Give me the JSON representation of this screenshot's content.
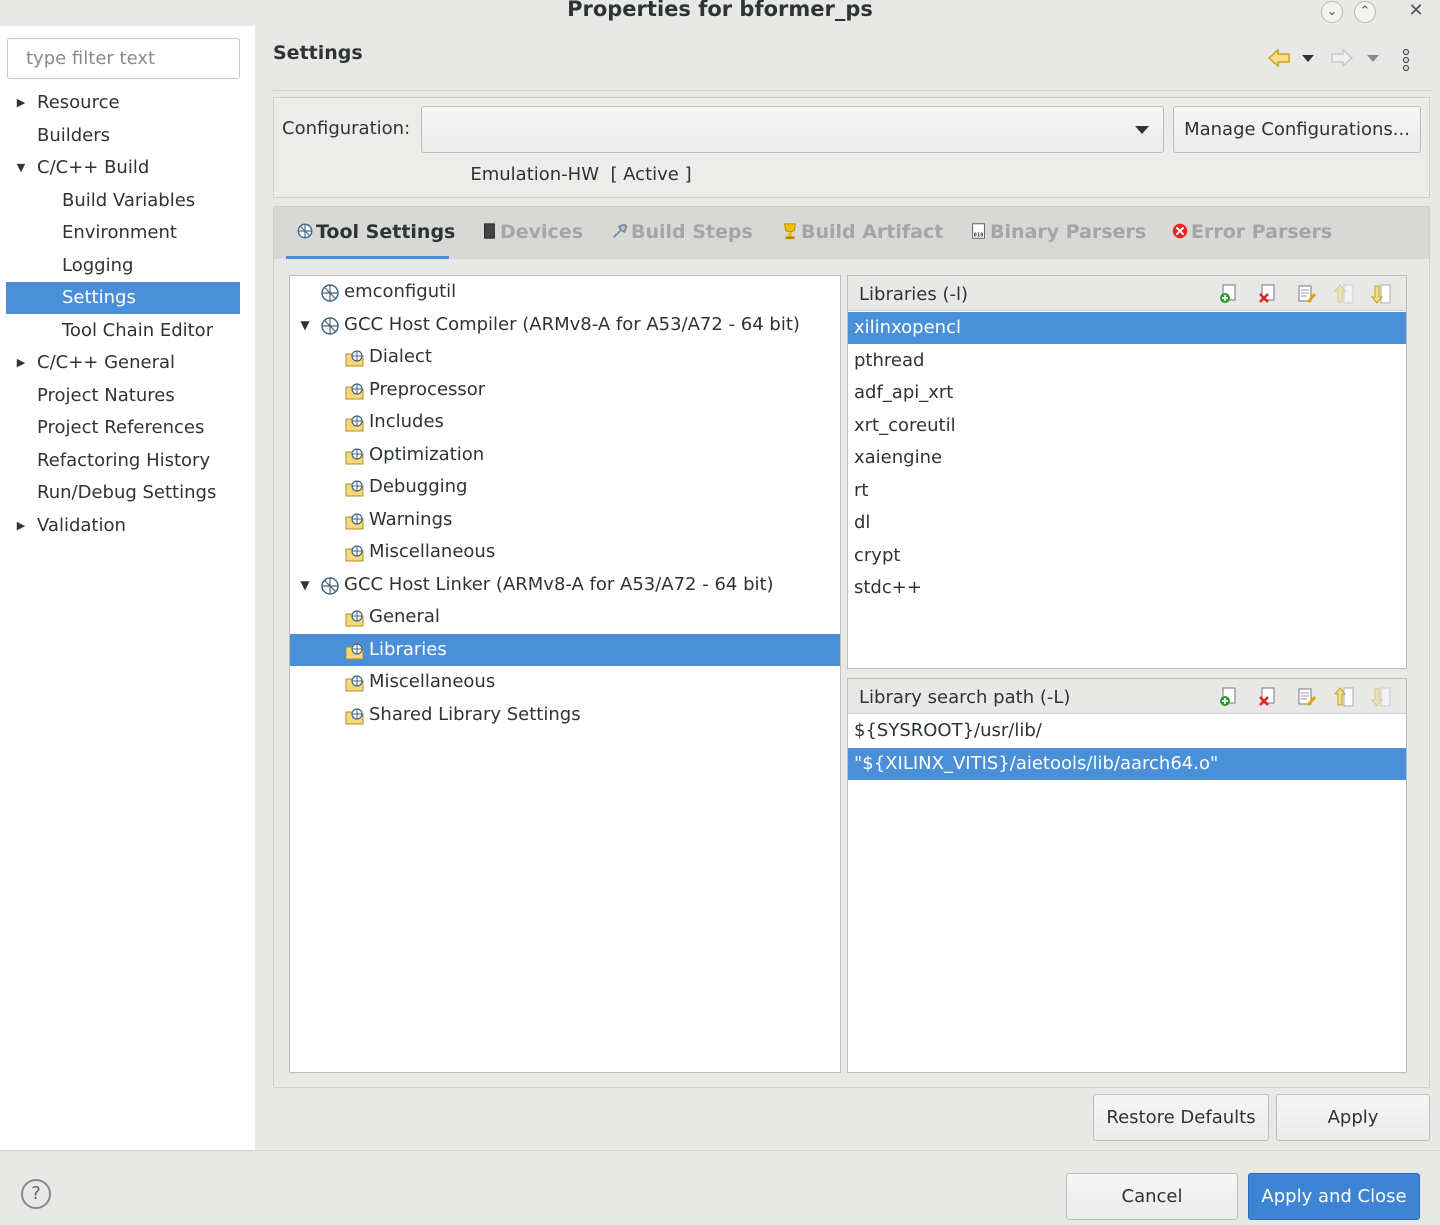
{
  "window": {
    "title": "Properties for bformer_ps",
    "controls": [
      "minimize-icon",
      "maximize-icon",
      "close-icon"
    ]
  },
  "left_nav": {
    "filter_placeholder": "type filter text",
    "items": [
      {
        "label": "Resource",
        "expander": "collapsed"
      },
      {
        "label": "Builders"
      },
      {
        "label": "C/C++ Build",
        "expander": "expanded"
      },
      {
        "label": "Build Variables"
      },
      {
        "label": "Environment"
      },
      {
        "label": "Logging"
      },
      {
        "label": "Settings",
        "selected": true
      },
      {
        "label": "Tool Chain Editor"
      },
      {
        "label": "C/C++ General",
        "expander": "collapsed"
      },
      {
        "label": "Project Natures"
      },
      {
        "label": "Project References"
      },
      {
        "label": "Refactoring History"
      },
      {
        "label": "Run/Debug Settings"
      },
      {
        "label": "Validation",
        "expander": "collapsed"
      }
    ]
  },
  "header": {
    "title": "Settings",
    "icons": [
      "back-arrow-icon",
      "back-menu-icon",
      "forward-arrow-icon",
      "forward-menu-icon",
      "view-menu-icon"
    ]
  },
  "configuration": {
    "label": "Configuration:",
    "selected": "Emulation-HW  [ Active ]",
    "manage_label": "Manage Configurations..."
  },
  "tabs": [
    {
      "label": "Tool Settings",
      "icon": "tool-settings-icon",
      "active": true
    },
    {
      "label": "Devices",
      "icon": "devices-icon"
    },
    {
      "label": "Build Steps",
      "icon": "build-steps-icon"
    },
    {
      "label": "Build Artifact",
      "icon": "build-artifact-icon"
    },
    {
      "label": "Binary Parsers",
      "icon": "binary-parsers-icon"
    },
    {
      "label": "Error Parsers",
      "icon": "error-parsers-icon"
    }
  ],
  "tool_tree": [
    {
      "label": "emconfigutil",
      "icon": "tool-icon"
    },
    {
      "label": "GCC Host Compiler (ARMv8-A for A53/A72 - 64 bit)",
      "icon": "tool-icon",
      "expander": "expanded"
    },
    {
      "label": "Dialect",
      "icon": "option-category-icon"
    },
    {
      "label": "Preprocessor",
      "icon": "option-category-icon"
    },
    {
      "label": "Includes",
      "icon": "option-category-icon"
    },
    {
      "label": "Optimization",
      "icon": "option-category-icon"
    },
    {
      "label": "Debugging",
      "icon": "option-category-icon"
    },
    {
      "label": "Warnings",
      "icon": "option-category-icon"
    },
    {
      "label": "Miscellaneous",
      "icon": "option-category-icon"
    },
    {
      "label": "GCC Host Linker (ARMv8-A for A53/A72 - 64 bit)",
      "icon": "tool-icon",
      "expander": "expanded"
    },
    {
      "label": "General",
      "icon": "option-category-icon"
    },
    {
      "label": "Libraries",
      "icon": "option-category-icon",
      "selected": true
    },
    {
      "label": "Miscellaneous",
      "icon": "option-category-icon"
    },
    {
      "label": "Shared Library Settings",
      "icon": "option-category-icon"
    }
  ],
  "libraries": {
    "title": "Libraries (-l)",
    "toolbar": [
      "add-icon",
      "delete-icon",
      "edit-icon",
      "move-up-icon",
      "move-down-icon"
    ],
    "items": [
      "xilinxopencl",
      "pthread",
      "adf_api_xrt",
      "xrt_coreutil",
      "xaiengine",
      "rt",
      "dl",
      "crypt",
      "stdc++"
    ],
    "selected_index": 0
  },
  "library_paths": {
    "title": "Library search path (-L)",
    "toolbar": [
      "add-icon",
      "delete-icon",
      "edit-icon",
      "move-up-icon",
      "move-down-icon"
    ],
    "items": [
      "${SYSROOT}/usr/lib/",
      "\"${XILINX_VITIS}/aietools/lib/aarch64.o\""
    ],
    "selected_index": 1
  },
  "page_buttons": {
    "restore_defaults": "Restore Defaults",
    "apply": "Apply"
  },
  "dialog_buttons": {
    "help_glyph": "?",
    "cancel": "Cancel",
    "apply_and_close": "Apply and Close"
  },
  "colors": {
    "selection": "#4a90d9",
    "primary_button": "#3d84d4",
    "disabled_tab_text": "#a3a5a6"
  }
}
